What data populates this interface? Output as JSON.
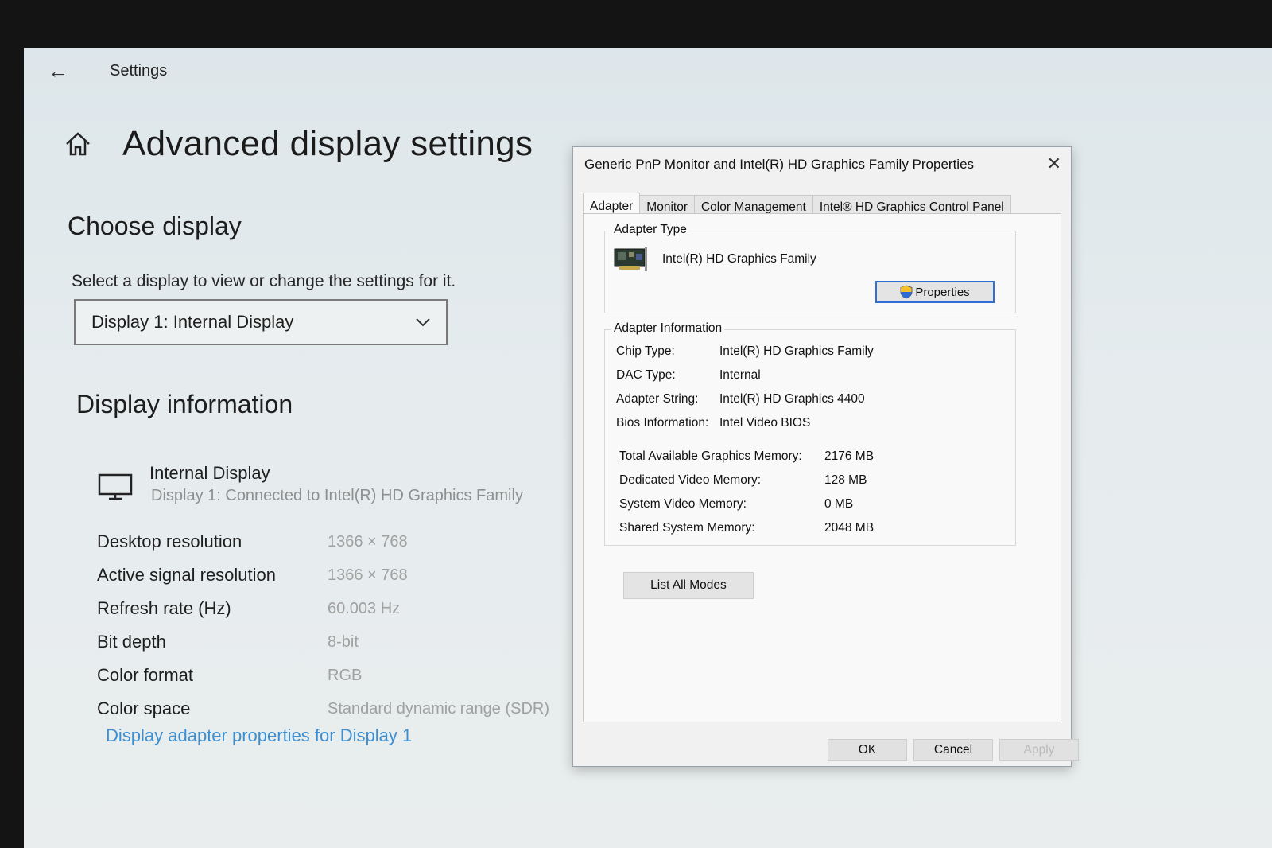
{
  "settings": {
    "window_title": "Settings",
    "page_title": "Advanced display settings",
    "choose_display": "Choose display",
    "select_label": "Select a display to view or change the settings for it.",
    "selected_display": "Display 1: Internal Display",
    "display_info_heading": "Display information",
    "display_name": "Internal Display",
    "display_connected": "Display 1: Connected to Intel(R) HD Graphics Family",
    "info_rows": [
      {
        "label": "Desktop resolution",
        "value": "1366 × 768"
      },
      {
        "label": "Active signal resolution",
        "value": "1366 × 768"
      },
      {
        "label": "Refresh rate (Hz)",
        "value": "60.003 Hz"
      },
      {
        "label": "Bit depth",
        "value": "8-bit"
      },
      {
        "label": "Color format",
        "value": "RGB"
      },
      {
        "label": "Color space",
        "value": "Standard dynamic range (SDR)"
      }
    ],
    "adapter_link": "Display adapter properties for Display 1"
  },
  "dialog": {
    "title": "Generic PnP Monitor and Intel(R) HD Graphics Family Properties",
    "close": "✕",
    "tabs": [
      "Adapter",
      "Monitor",
      "Color Management",
      "Intel® HD Graphics Control Panel"
    ],
    "adapter_type_label": "Adapter Type",
    "adapter_name": "Intel(R) HD Graphics Family",
    "properties_button": "Properties",
    "adapter_info_label": "Adapter Information",
    "info": [
      {
        "label": "Chip Type:",
        "value": "Intel(R) HD Graphics Family"
      },
      {
        "label": "DAC Type:",
        "value": "Internal"
      },
      {
        "label": "Adapter String:",
        "value": "Intel(R) HD Graphics 4400"
      },
      {
        "label": "Bios Information:",
        "value": "Intel Video BIOS"
      }
    ],
    "memory": [
      {
        "label": "Total Available Graphics Memory:",
        "value": "2176 MB"
      },
      {
        "label": "Dedicated Video Memory:",
        "value": "128 MB"
      },
      {
        "label": "System Video Memory:",
        "value": "0 MB"
      },
      {
        "label": "Shared System Memory:",
        "value": "2048 MB"
      }
    ],
    "list_all_modes": "List All Modes",
    "ok": "OK",
    "cancel": "Cancel",
    "apply": "Apply"
  },
  "colors": {
    "link": "#3d8fd1",
    "focus_border": "#2f6fd6"
  }
}
